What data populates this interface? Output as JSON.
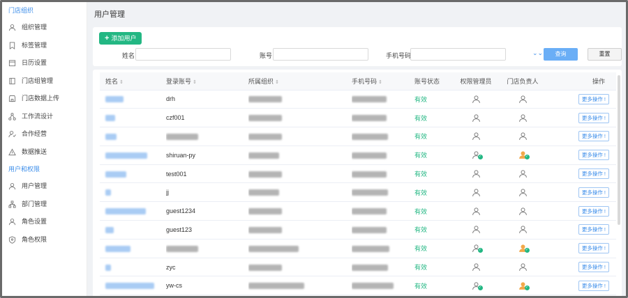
{
  "sidebar": {
    "section_store": "门店组织",
    "section_user": "用户和权限",
    "store_items": [
      {
        "label": "组织管理",
        "icon": "org-icon"
      },
      {
        "label": "标签管理",
        "icon": "bookmark-icon"
      },
      {
        "label": "日历设置",
        "icon": "calendar-icon"
      },
      {
        "label": "门店组管理",
        "icon": "store-group-icon"
      },
      {
        "label": "门店数据上传",
        "icon": "store-upload-icon"
      },
      {
        "label": "工作流设计",
        "icon": "workflow-icon"
      },
      {
        "label": "合作经营",
        "icon": "cooperation-icon"
      },
      {
        "label": "数据推送",
        "icon": "push-icon"
      }
    ],
    "user_items": [
      {
        "label": "用户管理",
        "icon": "user-manage-icon"
      },
      {
        "label": "部门管理",
        "icon": "department-icon"
      },
      {
        "label": "角色设置",
        "icon": "role-icon"
      },
      {
        "label": "角色权限",
        "icon": "shield-icon"
      }
    ]
  },
  "page_title": "用户管理",
  "toolbar": {
    "add_user": "添加用户"
  },
  "filters": {
    "name_label": "姓名",
    "account_label": "账号",
    "phone_label": "手机号码",
    "name_value": "",
    "account_value": "",
    "phone_value": "",
    "query": "查询",
    "reset": "重置"
  },
  "table": {
    "headers": [
      "姓名",
      "登录账号",
      "所属组织",
      "手机号码",
      "账号状态",
      "权限管理员",
      "门店负责人",
      "操作"
    ],
    "more_label": "更多操作 !",
    "rows": [
      {
        "account": "drh",
        "status": "有效",
        "admin": false,
        "owner": false
      },
      {
        "account": "czf001",
        "status": "有效",
        "admin": false,
        "owner": false
      },
      {
        "account": "",
        "status": "有效",
        "admin": false,
        "owner": false
      },
      {
        "account": "shiruan-py",
        "status": "有效",
        "admin": true,
        "owner": true
      },
      {
        "account": "test001",
        "status": "有效",
        "admin": false,
        "owner": false
      },
      {
        "account": "jj",
        "status": "有效",
        "admin": false,
        "owner": false
      },
      {
        "account": "guest1234",
        "status": "有效",
        "admin": false,
        "owner": false
      },
      {
        "account": "guest123",
        "status": "有效",
        "admin": false,
        "owner": false
      },
      {
        "account": "",
        "status": "有效",
        "admin": true,
        "owner": true
      },
      {
        "account": "zyc",
        "status": "有效",
        "admin": false,
        "owner": false
      },
      {
        "account": "yw-cs",
        "status": "有效",
        "admin": true,
        "owner": true
      }
    ]
  },
  "colors": {
    "accent": "#3d8eea",
    "success": "#23b783",
    "owner": "#f2a94a"
  }
}
